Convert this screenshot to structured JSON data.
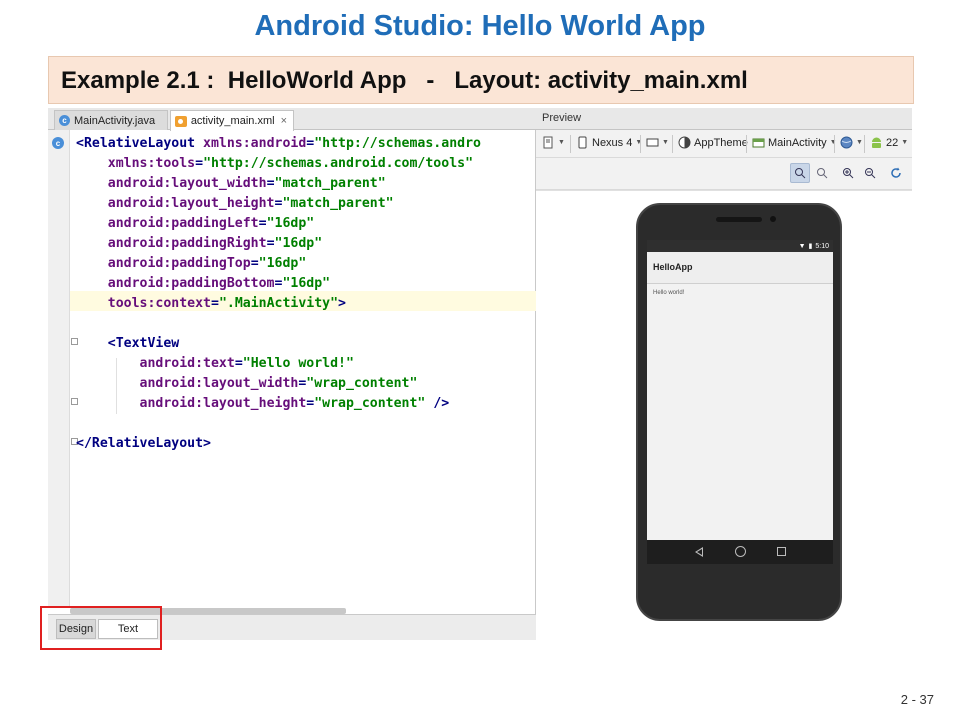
{
  "slide": {
    "title": "Android Studio: Hello World App",
    "subtitle": "Example 2.1 :  HelloWorld App   -   Layout: activity_main.xml",
    "page_number": "2 - 37"
  },
  "editor": {
    "tabs": [
      {
        "label": "MainActivity.java",
        "icon": "java-class-icon",
        "active": false
      },
      {
        "label": "activity_main.xml",
        "icon": "xml-layout-icon",
        "active": true,
        "close": "×"
      }
    ],
    "gutter_class_marker": "c",
    "code_lines": [
      "<RelativeLayout xmlns:android=\"http://schemas.andro",
      "    xmlns:tools=\"http://schemas.android.com/tools\"",
      "    android:layout_width=\"match_parent\"",
      "    android:layout_height=\"match_parent\"",
      "    android:paddingLeft=\"16dp\"",
      "    android:paddingRight=\"16dp\"",
      "    android:paddingTop=\"16dp\"",
      "    android:paddingBottom=\"16dp\"",
      "    tools:context=\".MainActivity\">",
      "",
      "    <TextView",
      "        android:text=\"Hello world!\"",
      "        android:layout_width=\"wrap_content\"",
      "        android:layout_height=\"wrap_content\" />",
      "",
      "</RelativeLayout>"
    ],
    "bottom_tabs": [
      {
        "label": "Design",
        "active": false
      },
      {
        "label": "Text",
        "active": true
      }
    ],
    "highlight_color": "#e02020"
  },
  "preview": {
    "header": "Preview",
    "toolbar": {
      "device": "Nexus 4",
      "theme": "AppTheme",
      "activity": "MainActivity",
      "api_level": "22"
    },
    "zoom_icons": [
      "zoom-actual-icon",
      "zoom-fit-icon",
      "zoom-in-icon",
      "zoom-out-icon",
      "refresh-icon"
    ],
    "phone": {
      "status_time": "5:10",
      "app_title": "HelloApp",
      "content_text": "Hello world!"
    }
  }
}
